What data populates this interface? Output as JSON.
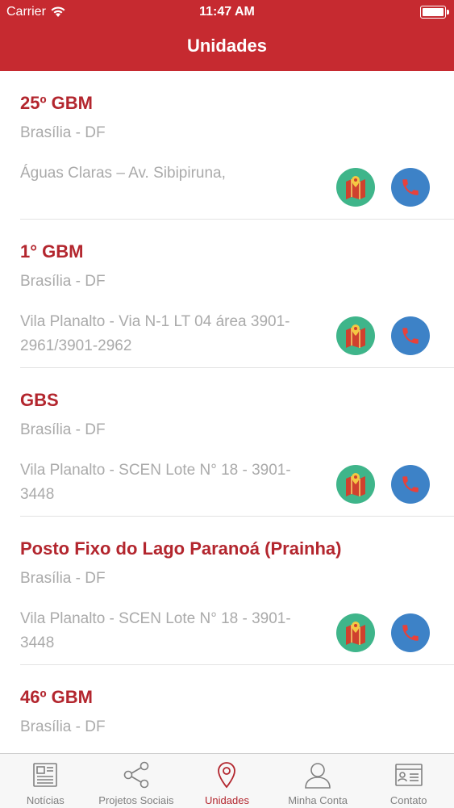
{
  "status_bar": {
    "carrier": "Carrier",
    "time": "11:47 AM"
  },
  "header": {
    "title": "Unidades"
  },
  "units": [
    {
      "name": "25º GBM",
      "city": "Brasília - DF",
      "address": "Águas Claras – Av. Sibipiruna,"
    },
    {
      "name": "1° GBM",
      "city": "Brasília - DF",
      "address": "Vila Planalto - Via N-1 LT 04 área 3901-2961/3901-2962"
    },
    {
      "name": "GBS",
      "city": "Brasília - DF",
      "address": "Vila Planalto - SCEN Lote N° 18 - 3901-3448"
    },
    {
      "name": "Posto Fixo do Lago Paranoá (Prainha)",
      "city": "Brasília - DF",
      "address": "Vila Planalto - SCEN Lote N° 18 - 3901-3448"
    },
    {
      "name": "46º GBM",
      "city": "Brasília - DF",
      "address": ""
    }
  ],
  "tabbar": {
    "tabs": [
      {
        "label": "Notícias",
        "icon": "newspaper-icon"
      },
      {
        "label": "Projetos Sociais",
        "icon": "share-icon"
      },
      {
        "label": "Unidades",
        "icon": "map-pin-icon",
        "active": true
      },
      {
        "label": "Minha Conta",
        "icon": "user-icon"
      },
      {
        "label": "Contato",
        "icon": "contact-card-icon"
      }
    ]
  },
  "colors": {
    "header": "#c62a30",
    "accent": "#b3262e",
    "map_button": "#3fb58a",
    "phone_button": "#3d82c7"
  }
}
